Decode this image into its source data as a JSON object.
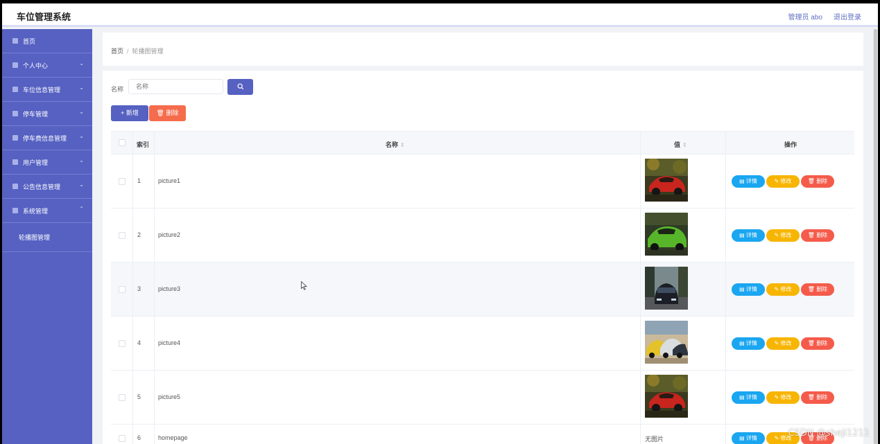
{
  "app": {
    "title": "车位管理系统",
    "admin_label": "管理员 abo",
    "logout_label": "退出登录"
  },
  "sidebar": {
    "items": [
      {
        "label": "首页",
        "icon": "home-icon",
        "has_chevron": false
      },
      {
        "label": "个人中心",
        "icon": "user-icon",
        "chevron": "⌄"
      },
      {
        "label": "车位信息管理",
        "icon": "monitor-icon",
        "chevron": "⌄"
      },
      {
        "label": "停车管理",
        "icon": "briefcase-icon",
        "chevron": "⌄"
      },
      {
        "label": "停车费信息管理",
        "icon": "filter-icon",
        "chevron": "⌄"
      },
      {
        "label": "用户管理",
        "icon": "document-icon",
        "chevron": "⌄"
      },
      {
        "label": "公告信息管理",
        "icon": "shield-icon",
        "chevron": "⌄"
      },
      {
        "label": "系统管理",
        "icon": "grid-icon",
        "chevron": "⌃"
      }
    ],
    "submenu": {
      "label": "轮播图管理"
    }
  },
  "breadcrumb": {
    "home": "首页",
    "separator": "/",
    "current": "轮播图管理"
  },
  "search": {
    "label": "名称",
    "placeholder": "名称",
    "button_icon": "search-icon"
  },
  "actions": {
    "add_label": "+ 新增",
    "delete_label": "删除"
  },
  "table": {
    "headers": {
      "index": "索引",
      "name": "名称",
      "value": "值",
      "operation": "操作",
      "sort_glyph": "⇕"
    },
    "rows": [
      {
        "index": "1",
        "name": "picture1",
        "value_type": "image",
        "image": "red-sports-car"
      },
      {
        "index": "2",
        "name": "picture2",
        "value_type": "image",
        "image": "green-sports-car"
      },
      {
        "index": "3",
        "name": "picture3",
        "value_type": "image",
        "image": "dark-car-front"
      },
      {
        "index": "4",
        "name": "picture4",
        "value_type": "image",
        "image": "group-of-cars"
      },
      {
        "index": "5",
        "name": "picture5",
        "value_type": "image",
        "image": "red-sports-car"
      },
      {
        "index": "6",
        "name": "homepage",
        "value_type": "text",
        "value_text": "无图片"
      }
    ],
    "row_buttons": {
      "detail": "详情",
      "edit": "修改",
      "remove": "删除"
    }
  },
  "watermark": "CSDN @sheji1211",
  "colors": {
    "primary": "#5661c2",
    "danger": "#f56c4d",
    "info": "#1aa6f0",
    "warning": "#f7b500"
  }
}
